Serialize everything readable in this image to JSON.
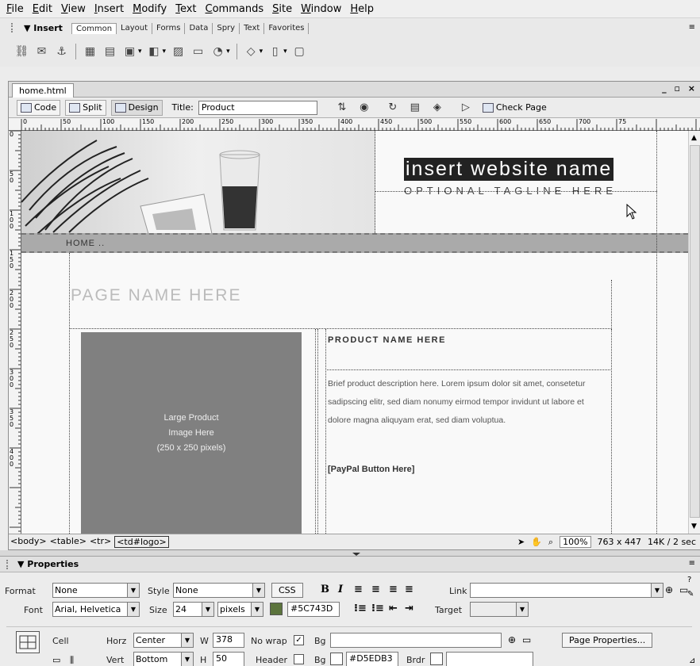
{
  "menu": [
    "File",
    "Edit",
    "View",
    "Insert",
    "Modify",
    "Text",
    "Commands",
    "Site",
    "Window",
    "Help"
  ],
  "insert": {
    "title": "▼ Insert",
    "tabs": [
      "Common",
      "Layout",
      "Forms",
      "Data",
      "Spry",
      "Text",
      "Favorites"
    ],
    "icons": [
      "hyperlink-icon",
      "email-link-icon",
      "named-anchor-icon",
      "table-icon",
      "div-icon",
      "images-icon",
      "media-icon",
      "date-icon",
      "comment-icon",
      "templates-icon",
      "head-icon",
      "script-icon",
      "tag-chooser-icon"
    ]
  },
  "document": {
    "tab_label": "home.html",
    "window_controls": "_ ▫ ×",
    "code_label": "Code",
    "split_label": "Split",
    "design_label": "Design",
    "title_label": "Title:",
    "title_value": "Product",
    "check_page_label": "Check Page"
  },
  "ruler": {
    "h_labels": [
      "0",
      "50",
      "100",
      "150",
      "200",
      "250",
      "300",
      "350",
      "400",
      "450",
      "500",
      "550",
      "600",
      "650",
      "700",
      "75"
    ],
    "v_labels": [
      "0",
      "5\n0",
      "1\n0\n0",
      "1\n5\n0",
      "2\n0\n0",
      "2\n5\n0",
      "3\n0\n0",
      "3\n5\n0",
      "4\n0\n0"
    ]
  },
  "canvas": {
    "site_name": "insert website name",
    "tagline": "OPTIONAL TAGLINE HERE",
    "nav_home": "HOME ..",
    "page_name": "PAGE NAME HERE",
    "image_lines": [
      "Large Product",
      "Image Here",
      "(250 x 250 pixels)"
    ],
    "product_name": "PRODUCT NAME HERE",
    "product_description": "Brief product description here. Lorem ipsum dolor sit amet, consetetur sadipscing elitr, sed diam nonumy eirmod tempor invidunt ut labore et dolore magna aliquyam erat, sed diam voluptua.",
    "paypal": "[PayPal Button Here]"
  },
  "status": {
    "tags": [
      "<body>",
      "<table>",
      "<tr>",
      "<td#logo>"
    ],
    "zoom": "100%",
    "window_size": "763 x 447",
    "file_size": "14K / 2 sec"
  },
  "properties": {
    "title": "▼ Properties",
    "format_label": "Format",
    "format_value": "None",
    "style_label": "Style",
    "style_value": "None",
    "css_label": "CSS",
    "link_label": "Link",
    "link_value": "",
    "font_label": "Font",
    "font_value": "Arial, Helvetica",
    "size_label": "Size",
    "size_value": "24",
    "unit_value": "pixels",
    "color_value": "#5C743D",
    "target_label": "Target",
    "target_value": "",
    "cell_label": "Cell",
    "horz_label": "Horz",
    "horz_value": "Center",
    "w_label": "W",
    "w_value": "378",
    "nowrap_label": "No wrap",
    "nowrap_checked": true,
    "bg_label": "Bg",
    "bg_value": "",
    "page_props_label": "Page Properties...",
    "vert_label": "Vert",
    "vert_value": "Bottom",
    "h_label": "H",
    "h_value": "50",
    "header_label": "Header",
    "header_checked": false,
    "bg2_label": "Bg",
    "bg_color_value": "#D5EDB3",
    "brdr_label": "Brdr",
    "text_color": "#5C743D",
    "bg_color": "#D5EDB3"
  }
}
